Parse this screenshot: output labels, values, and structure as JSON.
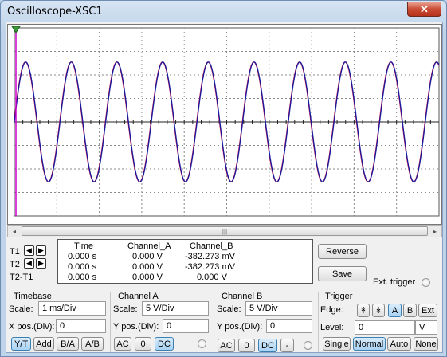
{
  "window": {
    "title": "Oscilloscope-XSC1",
    "close_label": "✕"
  },
  "scrollbar": {
    "left_arrow": "◂",
    "right_arrow": "▸",
    "grip": "|||"
  },
  "cursors": {
    "t1_label": "T1",
    "t2_label": "T2",
    "diff_label": "T2-T1",
    "left_arrow": "◀",
    "right_arrow": "▶"
  },
  "readout": {
    "headers": [
      "Time",
      "Channel_A",
      "Channel_B"
    ],
    "rows": [
      [
        "0.000 s",
        "0.000 V",
        "-382.273 mV"
      ],
      [
        "0.000 s",
        "0.000 V",
        "-382.273 mV"
      ],
      [
        "0.000 s",
        "0.000 V",
        "0.000 V"
      ]
    ]
  },
  "actions": {
    "reverse": "Reverse",
    "save": "Save",
    "ext_trigger": "Ext. trigger"
  },
  "timebase": {
    "title": "Timebase",
    "scale_label": "Scale:",
    "scale_value": "1 ms/Div",
    "xpos_label": "X pos.(Div):",
    "xpos_value": "0",
    "modes": [
      "Y/T",
      "Add",
      "B/A",
      "A/B"
    ],
    "active_mode": "Y/T"
  },
  "channel_a": {
    "title": "Channel A",
    "scale_label": "Scale:",
    "scale_value": "5  V/Div",
    "ypos_label": "Y pos.(Div):",
    "ypos_value": "0",
    "coupling": [
      "AC",
      "0",
      "DC"
    ],
    "active_coupling": "DC"
  },
  "channel_b": {
    "title": "Channel B",
    "scale_label": "Scale:",
    "scale_value": "5  V/Div",
    "ypos_label": "Y pos.(Div):",
    "ypos_value": "0",
    "coupling": [
      "AC",
      "0",
      "DC",
      "-"
    ],
    "active_coupling": "DC"
  },
  "trigger": {
    "title": "Trigger",
    "edge_label": "Edge:",
    "edge_buttons": [
      "↟",
      "↡",
      "A",
      "B",
      "Ext"
    ],
    "active_source": "A",
    "level_label": "Level:",
    "level_value": "0",
    "level_unit": "V",
    "modes": [
      "Single",
      "Normal",
      "Auto",
      "None"
    ],
    "active_mode": "Normal"
  },
  "colors": {
    "trace_a": "#cc0033",
    "trace_b": "#1a1a9e",
    "grid": "#8a8a8a",
    "cursor_t1": "#cc00cc"
  },
  "waveform": {
    "cycles": 9.3,
    "amplitude_div": 2.55,
    "phase": 0.0
  }
}
